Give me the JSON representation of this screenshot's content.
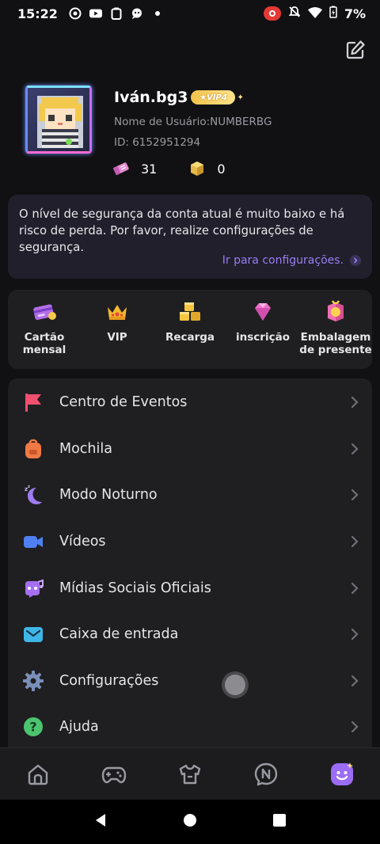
{
  "status_bar": {
    "time": "15:22",
    "battery": "7%",
    "left_icons": [
      "screen-record-icon",
      "youtube-icon",
      "clipboard-icon",
      "chat-bubble-icon",
      "dot-icon"
    ],
    "right_icons": [
      "recording-indicator-icon",
      "mute-icon",
      "wifi-icon",
      "battery-icon"
    ]
  },
  "profile": {
    "name": "Iván.bg3",
    "vip_badge": "VIP4",
    "username_line": "Nome de Usuário:NUMBERBG",
    "id_line": "ID: 6152951294",
    "tickets": "31",
    "cubes": "0"
  },
  "security": {
    "message": "O nível de segurança da conta atual é muito baixo e há risco de perda. Por favor, realize configurações de segurança.",
    "link_label": "Ir para configurações."
  },
  "shortcuts": [
    {
      "label": "Cartão\nmensal",
      "icon": "monthly-card-icon"
    },
    {
      "label": "VIP",
      "icon": "crown-icon"
    },
    {
      "label": "Recarga",
      "icon": "cubes-icon"
    },
    {
      "label": "inscrição",
      "icon": "diamond-icon"
    },
    {
      "label": "Embalagem\nde presente",
      "icon": "gift-pack-icon"
    }
  ],
  "menu": [
    {
      "label": "Centro de Eventos",
      "icon": "flag-icon"
    },
    {
      "label": "Mochila",
      "icon": "backpack-icon"
    },
    {
      "label": "Modo Noturno",
      "icon": "moon-icon"
    },
    {
      "label": "Vídeos",
      "icon": "video-camera-icon"
    },
    {
      "label": "Mídias Sociais Oficiais",
      "icon": "social-media-icon"
    },
    {
      "label": "Caixa de entrada",
      "icon": "mail-icon"
    },
    {
      "label": "Configurações",
      "icon": "gear-icon"
    },
    {
      "label": "Ajuda",
      "icon": "help-icon"
    }
  ],
  "bottom_nav": [
    {
      "icon": "home-icon"
    },
    {
      "icon": "gamepad-icon"
    },
    {
      "icon": "shirt-icon"
    },
    {
      "icon": "news-chat-icon"
    },
    {
      "icon": "profile-smile-icon",
      "active": true
    }
  ],
  "colors": {
    "accent": "#9a7cf3",
    "background": "#111113",
    "card": "#1f1f22",
    "security_card": "#211f2c"
  }
}
